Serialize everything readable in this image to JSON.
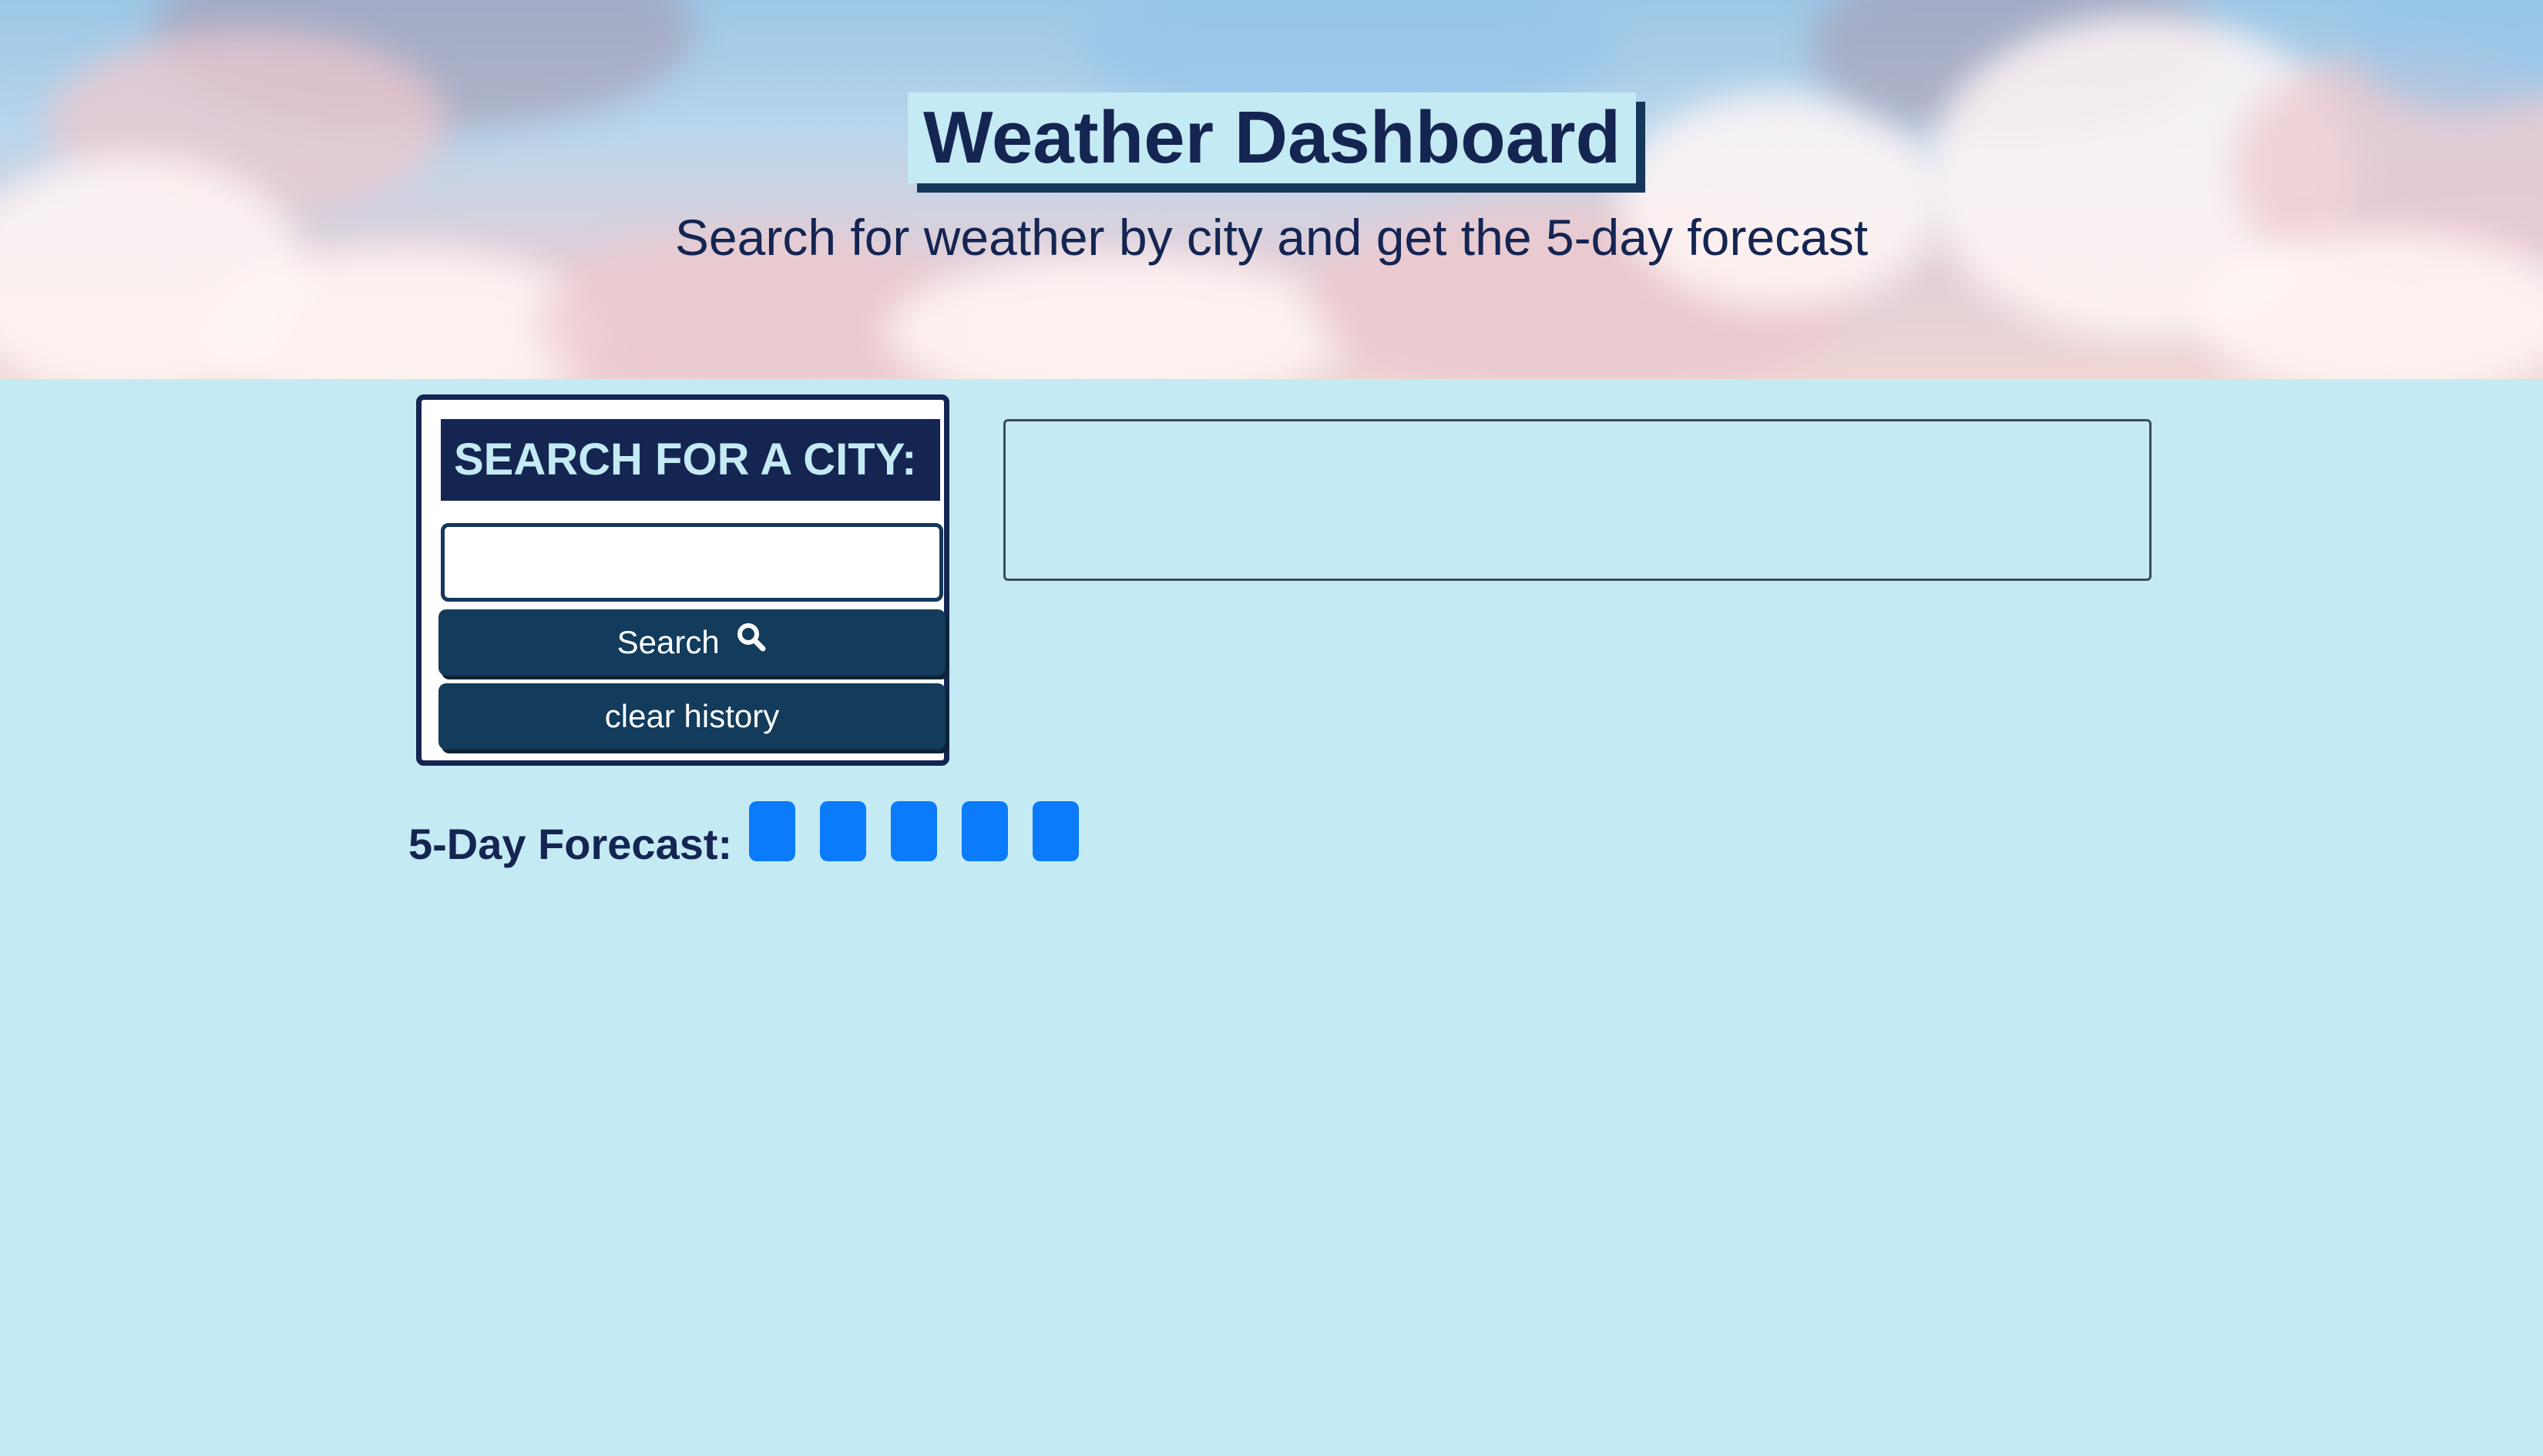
{
  "header": {
    "title": "Weather Dashboard",
    "subtitle": "Search for weather by city and get the 5-day forecast"
  },
  "search": {
    "heading": "SEARCH FOR A CITY:",
    "input_value": "",
    "placeholder": "",
    "search_button_label": "Search",
    "search_icon": "magnifying-glass-icon",
    "clear_button_label": "clear history"
  },
  "current_weather": {
    "content": ""
  },
  "forecast": {
    "label": "5-Day Forecast:",
    "days": [
      "",
      "",
      "",
      "",
      ""
    ]
  },
  "colors": {
    "page_background": "#c4eaf4",
    "navy": "#152552",
    "button": "#123b5c",
    "forecast_card": "#0a7bfa"
  }
}
